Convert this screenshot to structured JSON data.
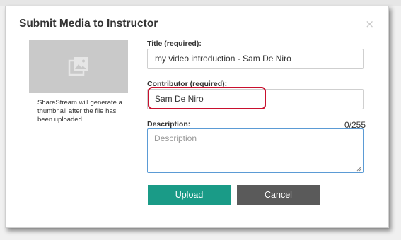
{
  "dialog": {
    "title": "Submit Media to Instructor",
    "close_icon": "×"
  },
  "thumbnail": {
    "icon": "image-placeholder-icon",
    "note": "ShareStream will generate a thumbnail after the file has been uploaded."
  },
  "form": {
    "title_label": "Title (required):",
    "title_value": "my video introduction - Sam De Niro",
    "contributor_label": "Contributor (required):",
    "contributor_value": "Sam De Niro",
    "description_label": "Description:",
    "description_counter": "0/255",
    "description_placeholder": "Description"
  },
  "buttons": {
    "upload_label": "Upload",
    "cancel_label": "Cancel"
  },
  "colors": {
    "upload_button": "#1a9b87",
    "cancel_button": "#5a5a5a",
    "highlight": "#c8102e",
    "focus_border": "#5b9bd5"
  }
}
